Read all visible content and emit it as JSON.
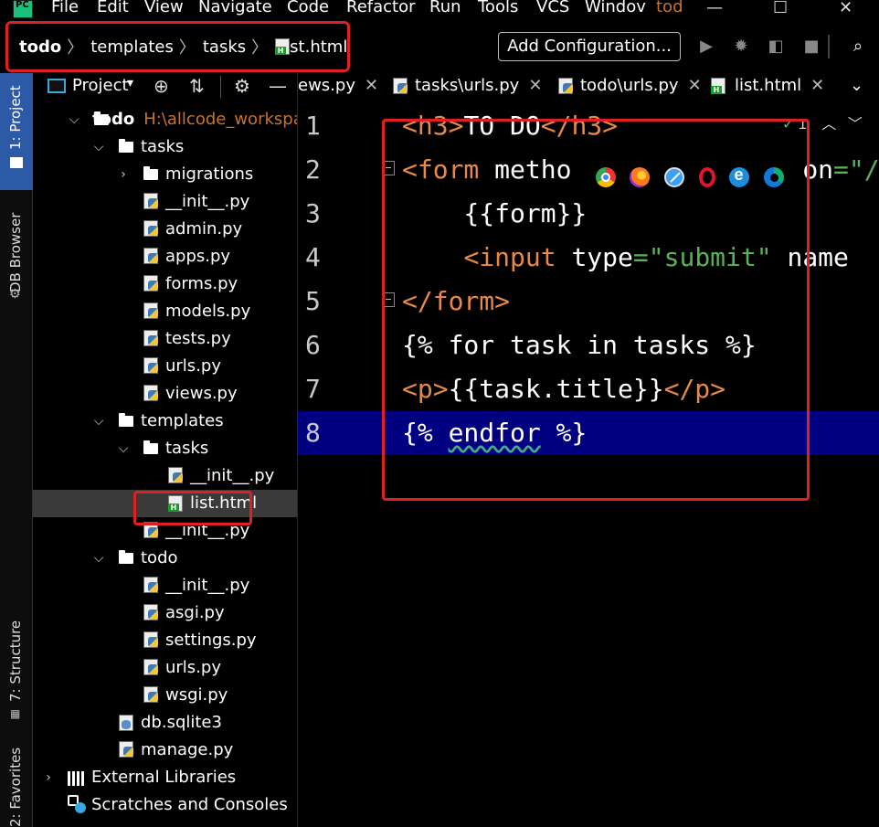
{
  "menubar": {
    "items": [
      "File",
      "Edit",
      "View",
      "Navigate",
      "Code",
      "Refactor",
      "Run",
      "Tools",
      "VCS",
      "Windov"
    ],
    "window_title": "tod",
    "logo_text": "PC"
  },
  "navbar": {
    "breadcrumb": [
      "todo",
      "templates",
      "tasks",
      "list.html"
    ],
    "add_configuration": "Add Configuration..."
  },
  "toolstrip": {
    "project_tab": "1: Project",
    "db_browser_tab": "DB Browser",
    "structure_tab": "7: Structure",
    "favorites_tab": "2: Favorites"
  },
  "project_panel": {
    "title": "Project",
    "root_name": "todo",
    "root_path": "H:\\allcode_workspac",
    "tree": [
      {
        "label": "tasks",
        "type": "folder",
        "indent": 1,
        "arrow": "open"
      },
      {
        "label": "migrations",
        "type": "folder",
        "indent": 2,
        "arrow": "closed"
      },
      {
        "label": "__init__.py",
        "type": "py",
        "indent": 2
      },
      {
        "label": "admin.py",
        "type": "py",
        "indent": 2
      },
      {
        "label": "apps.py",
        "type": "py",
        "indent": 2
      },
      {
        "label": "forms.py",
        "type": "py",
        "indent": 2
      },
      {
        "label": "models.py",
        "type": "py",
        "indent": 2
      },
      {
        "label": "tests.py",
        "type": "py",
        "indent": 2
      },
      {
        "label": "urls.py",
        "type": "py",
        "indent": 2
      },
      {
        "label": "views.py",
        "type": "py",
        "indent": 2
      },
      {
        "label": "templates",
        "type": "folder",
        "indent": 1,
        "arrow": "open"
      },
      {
        "label": "tasks",
        "type": "folder",
        "indent": 2,
        "arrow": "open"
      },
      {
        "label": "__init__.py",
        "type": "py",
        "indent": 3
      },
      {
        "label": "list.html",
        "type": "html",
        "indent": 3,
        "selected": true
      },
      {
        "label": "__init__.py",
        "type": "py",
        "indent": 2
      },
      {
        "label": "todo",
        "type": "folder",
        "indent": 1,
        "arrow": "open"
      },
      {
        "label": "__init__.py",
        "type": "py",
        "indent": 2
      },
      {
        "label": "asgi.py",
        "type": "py",
        "indent": 2
      },
      {
        "label": "settings.py",
        "type": "py",
        "indent": 2
      },
      {
        "label": "urls.py",
        "type": "py",
        "indent": 2
      },
      {
        "label": "wsgi.py",
        "type": "py",
        "indent": 2
      },
      {
        "label": "db.sqlite3",
        "type": "db",
        "indent": 1
      },
      {
        "label": "manage.py",
        "type": "py",
        "indent": 1
      },
      {
        "label": "External Libraries",
        "type": "lib",
        "indent": 0,
        "arrow": "closed"
      },
      {
        "label": "Scratches and Consoles",
        "type": "scratch",
        "indent": 0
      }
    ]
  },
  "editor_tabs": [
    {
      "label": "ews.py",
      "type": "partial"
    },
    {
      "label": "tasks\\urls.py",
      "type": "py"
    },
    {
      "label": "todo\\urls.py",
      "type": "py"
    },
    {
      "label": "list.html",
      "type": "html",
      "active": true
    }
  ],
  "editor": {
    "inspection_count": "1",
    "current_line": 8,
    "lines": [
      {
        "n": "1",
        "parts": [
          [
            "tag",
            "<h3>"
          ],
          [
            "text",
            "TO DO"
          ],
          [
            "tag",
            "</h3>"
          ]
        ]
      },
      {
        "n": "2",
        "parts": [
          [
            "tag",
            "<form "
          ],
          [
            "attr",
            "metho"
          ],
          [
            "text",
            "               "
          ],
          [
            "attr",
            "on"
          ],
          [
            "str",
            "=\"/"
          ]
        ]
      },
      {
        "n": "3",
        "parts": [
          [
            "text",
            "    {{form}}"
          ]
        ]
      },
      {
        "n": "4",
        "parts": [
          [
            "text",
            "    "
          ],
          [
            "tag",
            "<input "
          ],
          [
            "attr",
            "type"
          ],
          [
            "str",
            "=\"submit\""
          ],
          [
            "text",
            " "
          ],
          [
            "attr",
            "name"
          ]
        ]
      },
      {
        "n": "5",
        "parts": [
          [
            "tag",
            "</form>"
          ]
        ]
      },
      {
        "n": "6",
        "parts": [
          [
            "text",
            "{% for task in tasks %}"
          ]
        ]
      },
      {
        "n": "7",
        "parts": [
          [
            "tag",
            "<p>"
          ],
          [
            "text",
            "{{task.title}}"
          ],
          [
            "tag",
            "</p>"
          ]
        ]
      },
      {
        "n": "8",
        "parts": [
          [
            "text",
            "{% "
          ],
          [
            "sq",
            "endfor"
          ],
          [
            "text",
            " %}"
          ]
        ]
      }
    ],
    "browsers": [
      "chrome-icon",
      "firefox-icon",
      "safari-icon",
      "opera-icon",
      "ie-icon",
      "edge-icon"
    ]
  },
  "colors": {
    "highlight": "#e02020",
    "current_line": "#000080",
    "tag": "#e8894a",
    "string": "#59b356",
    "project_tab": "#2d5aa6"
  }
}
